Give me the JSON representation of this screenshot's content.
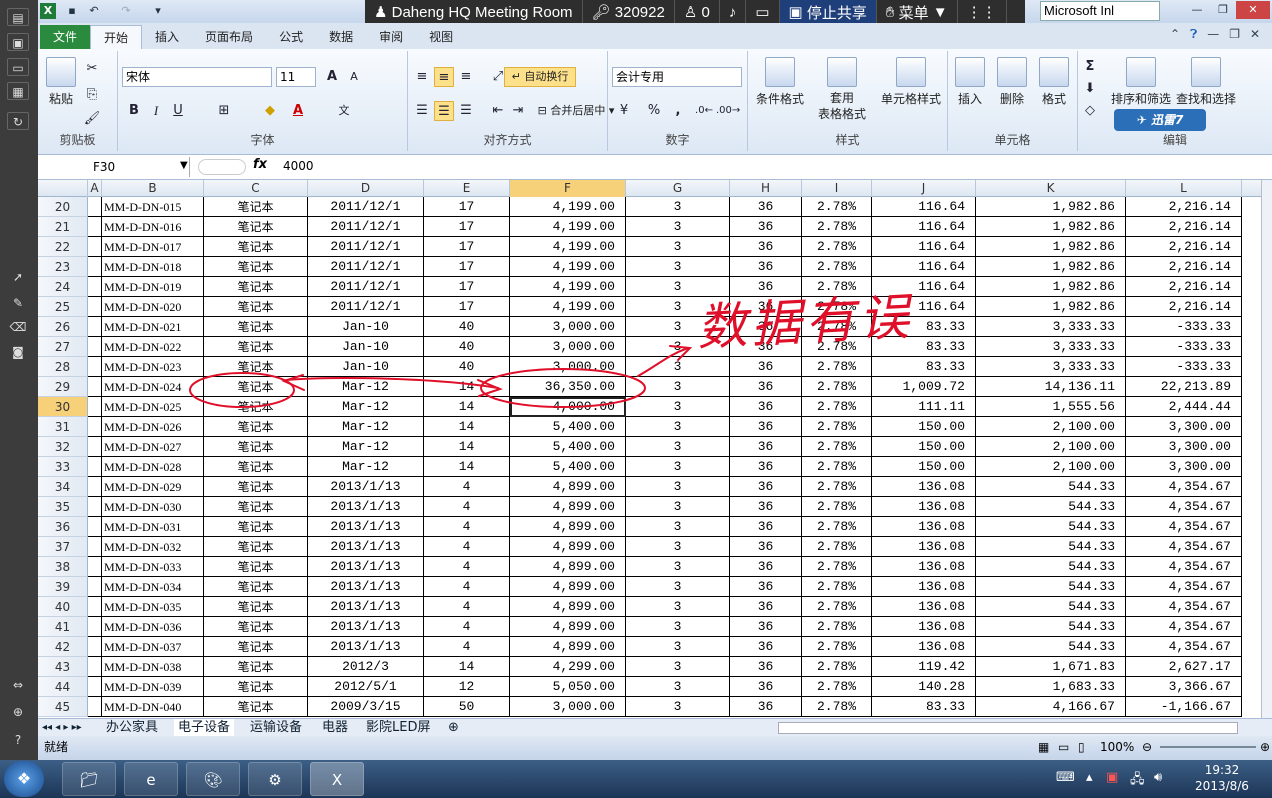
{
  "left_toolbar": {
    "items": [
      "share-icon",
      "screen-icon",
      "monitor-icon",
      "grid-icon",
      "refresh-icon",
      "pointer-icon",
      "pen-icon",
      "eraser-icon",
      "camera-icon",
      "swap-icon",
      "add-icon",
      "help-icon"
    ]
  },
  "titlebar": {
    "meeting_room": "Daheng HQ Meeting Room",
    "key_code": "320922",
    "participants": "0",
    "stop_share": "停止共享",
    "menu": "菜单",
    "app_title": "Microsoft Inl"
  },
  "tabs": [
    "文件",
    "开始",
    "插入",
    "页面布局",
    "公式",
    "数据",
    "审阅",
    "视图"
  ],
  "ribbon": {
    "clipboard": {
      "paste": "粘贴",
      "label": "剪贴板"
    },
    "font": {
      "name": "宋体",
      "size": "11",
      "label": "字体",
      "bold": "B",
      "italic": "I",
      "underline": "U",
      "grow": "A",
      "shrink": "A"
    },
    "align": {
      "wrap": "自动换行",
      "merge": "合并后居中",
      "label": "对齐方式"
    },
    "number": {
      "format": "会计专用",
      "label": "数字",
      "percent": "%",
      "comma": ","
    },
    "styles": {
      "cond": "条件格式",
      "table": "套用\n表格格式",
      "cell": "单元格样式",
      "label": "样式"
    },
    "cells": {
      "insert": "插入",
      "delete": "删除",
      "format": "格式",
      "label": "单元格"
    },
    "edit": {
      "sigma": "Σ",
      "sort": "排序和筛选",
      "find": "查找和选择",
      "label": "编辑",
      "xunlei": "迅雷7"
    }
  },
  "formula": {
    "cell": "F30",
    "fx": "fx",
    "value": "4000"
  },
  "columns": [
    "A",
    "B",
    "C",
    "D",
    "E",
    "F",
    "G",
    "H",
    "I",
    "J",
    "K",
    "L"
  ],
  "rows": [
    {
      "n": "20",
      "b": "MM-D-DN-015",
      "c": "笔记本",
      "d": "2011/12/1",
      "e": "17",
      "f": "4,199.00",
      "g": "3",
      "h": "36",
      "i": "2.78%",
      "j": "116.64",
      "k": "1,982.86",
      "l": "2,216.14"
    },
    {
      "n": "21",
      "b": "MM-D-DN-016",
      "c": "笔记本",
      "d": "2011/12/1",
      "e": "17",
      "f": "4,199.00",
      "g": "3",
      "h": "36",
      "i": "2.78%",
      "j": "116.64",
      "k": "1,982.86",
      "l": "2,216.14"
    },
    {
      "n": "22",
      "b": "MM-D-DN-017",
      "c": "笔记本",
      "d": "2011/12/1",
      "e": "17",
      "f": "4,199.00",
      "g": "3",
      "h": "36",
      "i": "2.78%",
      "j": "116.64",
      "k": "1,982.86",
      "l": "2,216.14"
    },
    {
      "n": "23",
      "b": "MM-D-DN-018",
      "c": "笔记本",
      "d": "2011/12/1",
      "e": "17",
      "f": "4,199.00",
      "g": "3",
      "h": "36",
      "i": "2.78%",
      "j": "116.64",
      "k": "1,982.86",
      "l": "2,216.14"
    },
    {
      "n": "24",
      "b": "MM-D-DN-019",
      "c": "笔记本",
      "d": "2011/12/1",
      "e": "17",
      "f": "4,199.00",
      "g": "3",
      "h": "36",
      "i": "2.78%",
      "j": "116.64",
      "k": "1,982.86",
      "l": "2,216.14"
    },
    {
      "n": "25",
      "b": "MM-D-DN-020",
      "c": "笔记本",
      "d": "2011/12/1",
      "e": "17",
      "f": "4,199.00",
      "g": "3",
      "h": "36",
      "i": "2.78%",
      "j": "116.64",
      "k": "1,982.86",
      "l": "2,216.14"
    },
    {
      "n": "26",
      "b": "MM-D-DN-021",
      "c": "笔记本",
      "d": "Jan-10",
      "e": "40",
      "f": "3,000.00",
      "g": "3",
      "h": "36",
      "i": "2.78%",
      "j": "83.33",
      "k": "3,333.33",
      "l": "-333.33"
    },
    {
      "n": "27",
      "b": "MM-D-DN-022",
      "c": "笔记本",
      "d": "Jan-10",
      "e": "40",
      "f": "3,000.00",
      "g": "3",
      "h": "36",
      "i": "2.78%",
      "j": "83.33",
      "k": "3,333.33",
      "l": "-333.33"
    },
    {
      "n": "28",
      "b": "MM-D-DN-023",
      "c": "笔记本",
      "d": "Jan-10",
      "e": "40",
      "f": "3,000.00",
      "g": "3",
      "h": "36",
      "i": "2.78%",
      "j": "83.33",
      "k": "3,333.33",
      "l": "-333.33"
    },
    {
      "n": "29",
      "b": "MM-D-DN-024",
      "c": "笔记本",
      "d": "Mar-12",
      "e": "14",
      "f": "36,350.00",
      "g": "3",
      "h": "36",
      "i": "2.78%",
      "j": "1,009.72",
      "k": "14,136.11",
      "l": "22,213.89"
    },
    {
      "n": "30",
      "b": "MM-D-DN-025",
      "c": "笔记本",
      "d": "Mar-12",
      "e": "14",
      "f": "4,000.00",
      "g": "3",
      "h": "36",
      "i": "2.78%",
      "j": "111.11",
      "k": "1,555.56",
      "l": "2,444.44"
    },
    {
      "n": "31",
      "b": "MM-D-DN-026",
      "c": "笔记本",
      "d": "Mar-12",
      "e": "14",
      "f": "5,400.00",
      "g": "3",
      "h": "36",
      "i": "2.78%",
      "j": "150.00",
      "k": "2,100.00",
      "l": "3,300.00"
    },
    {
      "n": "32",
      "b": "MM-D-DN-027",
      "c": "笔记本",
      "d": "Mar-12",
      "e": "14",
      "f": "5,400.00",
      "g": "3",
      "h": "36",
      "i": "2.78%",
      "j": "150.00",
      "k": "2,100.00",
      "l": "3,300.00"
    },
    {
      "n": "33",
      "b": "MM-D-DN-028",
      "c": "笔记本",
      "d": "Mar-12",
      "e": "14",
      "f": "5,400.00",
      "g": "3",
      "h": "36",
      "i": "2.78%",
      "j": "150.00",
      "k": "2,100.00",
      "l": "3,300.00"
    },
    {
      "n": "34",
      "b": "MM-D-DN-029",
      "c": "笔记本",
      "d": "2013/1/13",
      "e": "4",
      "f": "4,899.00",
      "g": "3",
      "h": "36",
      "i": "2.78%",
      "j": "136.08",
      "k": "544.33",
      "l": "4,354.67"
    },
    {
      "n": "35",
      "b": "MM-D-DN-030",
      "c": "笔记本",
      "d": "2013/1/13",
      "e": "4",
      "f": "4,899.00",
      "g": "3",
      "h": "36",
      "i": "2.78%",
      "j": "136.08",
      "k": "544.33",
      "l": "4,354.67"
    },
    {
      "n": "36",
      "b": "MM-D-DN-031",
      "c": "笔记本",
      "d": "2013/1/13",
      "e": "4",
      "f": "4,899.00",
      "g": "3",
      "h": "36",
      "i": "2.78%",
      "j": "136.08",
      "k": "544.33",
      "l": "4,354.67"
    },
    {
      "n": "37",
      "b": "MM-D-DN-032",
      "c": "笔记本",
      "d": "2013/1/13",
      "e": "4",
      "f": "4,899.00",
      "g": "3",
      "h": "36",
      "i": "2.78%",
      "j": "136.08",
      "k": "544.33",
      "l": "4,354.67"
    },
    {
      "n": "38",
      "b": "MM-D-DN-033",
      "c": "笔记本",
      "d": "2013/1/13",
      "e": "4",
      "f": "4,899.00",
      "g": "3",
      "h": "36",
      "i": "2.78%",
      "j": "136.08",
      "k": "544.33",
      "l": "4,354.67"
    },
    {
      "n": "39",
      "b": "MM-D-DN-034",
      "c": "笔记本",
      "d": "2013/1/13",
      "e": "4",
      "f": "4,899.00",
      "g": "3",
      "h": "36",
      "i": "2.78%",
      "j": "136.08",
      "k": "544.33",
      "l": "4,354.67"
    },
    {
      "n": "40",
      "b": "MM-D-DN-035",
      "c": "笔记本",
      "d": "2013/1/13",
      "e": "4",
      "f": "4,899.00",
      "g": "3",
      "h": "36",
      "i": "2.78%",
      "j": "136.08",
      "k": "544.33",
      "l": "4,354.67"
    },
    {
      "n": "41",
      "b": "MM-D-DN-036",
      "c": "笔记本",
      "d": "2013/1/13",
      "e": "4",
      "f": "4,899.00",
      "g": "3",
      "h": "36",
      "i": "2.78%",
      "j": "136.08",
      "k": "544.33",
      "l": "4,354.67"
    },
    {
      "n": "42",
      "b": "MM-D-DN-037",
      "c": "笔记本",
      "d": "2013/1/13",
      "e": "4",
      "f": "4,899.00",
      "g": "3",
      "h": "36",
      "i": "2.78%",
      "j": "136.08",
      "k": "544.33",
      "l": "4,354.67"
    },
    {
      "n": "43",
      "b": "MM-D-DN-038",
      "c": "笔记本",
      "d": "2012/3",
      "e": "14",
      "f": "4,299.00",
      "g": "3",
      "h": "36",
      "i": "2.78%",
      "j": "119.42",
      "k": "1,671.83",
      "l": "2,627.17"
    },
    {
      "n": "44",
      "b": "MM-D-DN-039",
      "c": "笔记本",
      "d": "2012/5/1",
      "e": "12",
      "f": "5,050.00",
      "g": "3",
      "h": "36",
      "i": "2.78%",
      "j": "140.28",
      "k": "1,683.33",
      "l": "3,366.67"
    },
    {
      "n": "45",
      "b": "MM-D-DN-040",
      "c": "笔记本",
      "d": "2009/3/15",
      "e": "50",
      "f": "3,000.00",
      "g": "3",
      "h": "36",
      "i": "2.78%",
      "j": "83.33",
      "k": "4,166.67",
      "l": "-1,166.67"
    }
  ],
  "annotation": {
    "text": "数据有误",
    "color": "#e0102a"
  },
  "sheets": [
    "办公家具",
    "电子设备",
    "运输设备",
    "电器",
    "影院LED屏"
  ],
  "status": {
    "ready": "就绪",
    "zoom": "100%"
  },
  "clock": {
    "time": "19:32",
    "date": "2013/8/6"
  }
}
